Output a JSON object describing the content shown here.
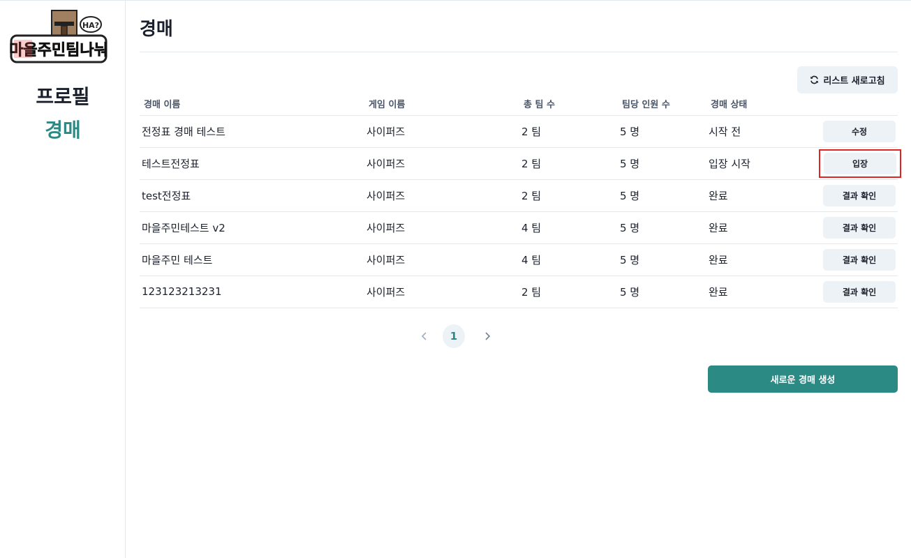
{
  "sidebar": {
    "logo_text": "마을주민팀나눠",
    "logo_bubble": "HA?",
    "items": [
      {
        "label": "프로필"
      },
      {
        "label": "경매"
      }
    ]
  },
  "main": {
    "title": "경매",
    "refresh_label": "리스트 새로고침",
    "table": {
      "headers": [
        "경매 이름",
        "게임 이름",
        "총 팀 수",
        "팀당 인원 수",
        "경매 상태"
      ],
      "rows": [
        {
          "name": "전정표 경매 테스트",
          "game": "사이퍼즈",
          "teams": "2 팀",
          "per_team": "5 명",
          "status": "시작 전",
          "action": "수정"
        },
        {
          "name": "테스트전정표",
          "game": "사이퍼즈",
          "teams": "2 팀",
          "per_team": "5 명",
          "status": "입장 시작",
          "action": "입장"
        },
        {
          "name": "test전정표",
          "game": "사이퍼즈",
          "teams": "2 팀",
          "per_team": "5 명",
          "status": "완료",
          "action": "결과 확인"
        },
        {
          "name": "마을주민테스트 v2",
          "game": "사이퍼즈",
          "teams": "4 팀",
          "per_team": "5 명",
          "status": "완료",
          "action": "결과 확인"
        },
        {
          "name": "마을주민 테스트",
          "game": "사이퍼즈",
          "teams": "4 팀",
          "per_team": "5 명",
          "status": "완료",
          "action": "결과 확인"
        },
        {
          "name": "123123213231",
          "game": "사이퍼즈",
          "teams": "2 팀",
          "per_team": "5 명",
          "status": "완료",
          "action": "결과 확인"
        }
      ]
    },
    "pagination": {
      "current_page": "1",
      "prev_icon": "chevron-left-icon",
      "next_icon": "chevron-right-icon"
    },
    "create_label": "새로운 경매 생성"
  },
  "colors": {
    "accent": "#2c8a85",
    "button_bg": "#edf2f7",
    "highlight": "#e02424"
  }
}
